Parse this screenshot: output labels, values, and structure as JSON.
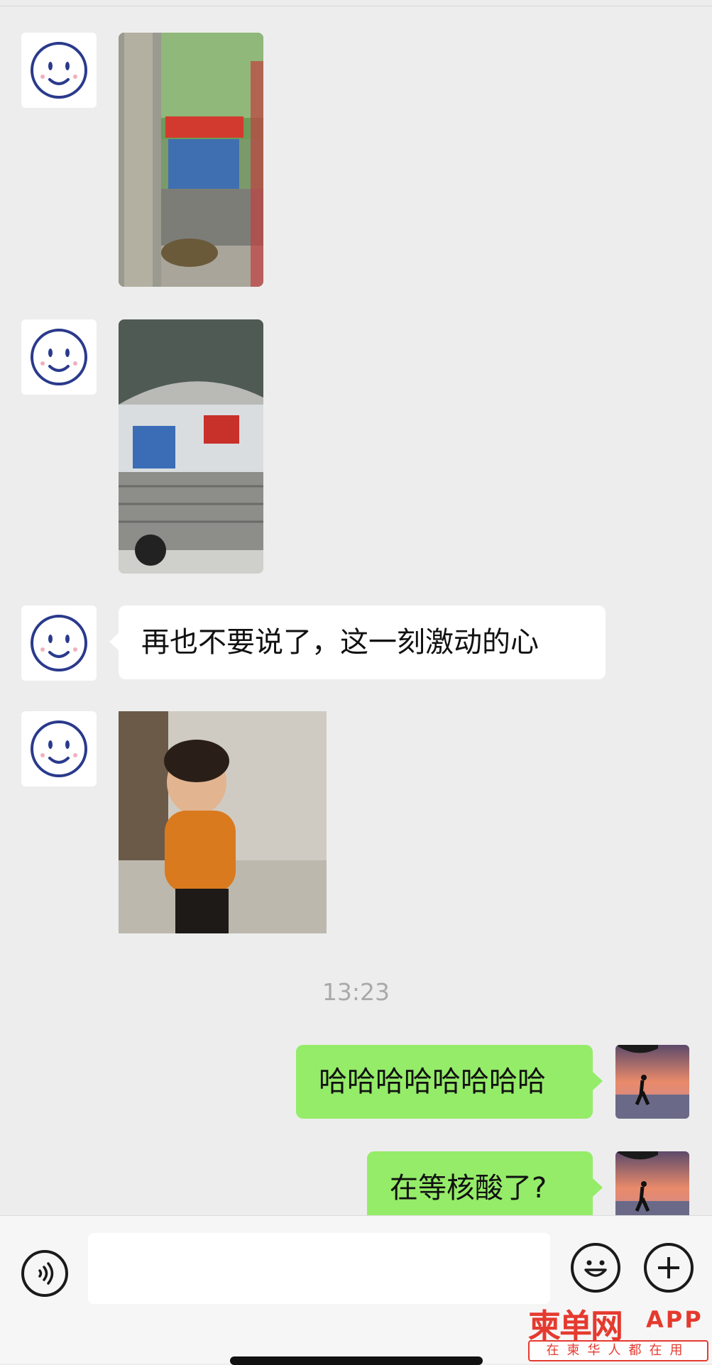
{
  "chat": {
    "received_text": "再也不要说了，这一刻激动的心",
    "timestamp": "13:23",
    "sent": [
      {
        "text": "哈哈哈哈哈哈哈哈"
      },
      {
        "text": "在等核酸了?"
      }
    ]
  },
  "input": {
    "voice_icon": "voice-icon",
    "emoji_icon": "emoji-icon",
    "plus_icon": "plus-icon",
    "placeholder": ""
  },
  "watermark": {
    "logo": "柬单网",
    "app": "APP",
    "tagline": "在柬华人都在用"
  },
  "colors": {
    "sent_bubble": "#95ec69",
    "received_bubble": "#ffffff",
    "background": "#ededed",
    "brand_red": "#e53a2f"
  }
}
